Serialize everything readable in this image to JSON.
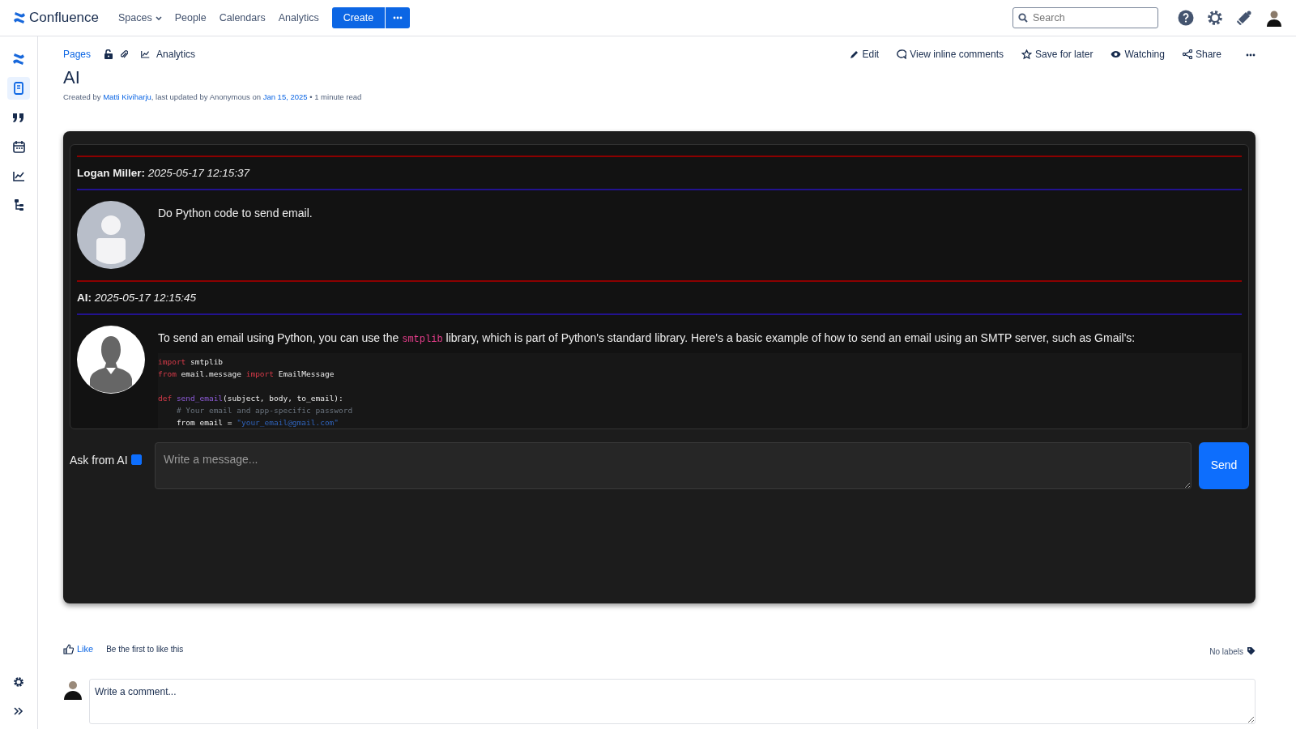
{
  "topbar": {
    "brand": "Confluence",
    "nav": [
      {
        "label": "Spaces",
        "dropdown": true
      },
      {
        "label": "People",
        "dropdown": false
      },
      {
        "label": "Calendars",
        "dropdown": false
      },
      {
        "label": "Analytics",
        "dropdown": false
      }
    ],
    "create_button": "Create",
    "search": {
      "placeholder": "Search"
    }
  },
  "sidebar": {
    "items": [
      {
        "kind": "logo",
        "selected": false
      },
      {
        "kind": "pages",
        "selected": true
      },
      {
        "kind": "quote",
        "selected": false
      },
      {
        "kind": "calendar",
        "selected": false
      },
      {
        "kind": "analytics",
        "selected": false
      },
      {
        "kind": "tree",
        "selected": false
      }
    ],
    "bottom": [
      {
        "kind": "settings"
      },
      {
        "kind": "expand"
      }
    ]
  },
  "page": {
    "breadcrumb": "Pages",
    "analytics_link": "Analytics",
    "actions": [
      {
        "kind": "edit",
        "label": "Edit"
      },
      {
        "kind": "comments",
        "label": "View inline comments"
      },
      {
        "kind": "star",
        "label": "Save for later"
      },
      {
        "kind": "watch",
        "label": "Watching"
      },
      {
        "kind": "share",
        "label": "Share"
      },
      {
        "kind": "more"
      }
    ],
    "title": "AI",
    "byline": {
      "prefix": "Created by ",
      "author": "Matti Kiviharju",
      "middle": ", last updated by Anonymous on ",
      "date": "Jan 15, 2025",
      "suffix": " • 1 minute read"
    }
  },
  "chat": {
    "messages": [
      {
        "kind": "user",
        "author": "Logan Miller:",
        "time": "2025-05-17 12:15:37",
        "parts": [
          {
            "kind": "text",
            "text": "Do Python code to send email."
          }
        ]
      },
      {
        "kind": "ai",
        "author": "AI:",
        "time": "2025-05-17 12:15:45",
        "parts": [
          {
            "kind": "text",
            "text": "To send an email using Python, you can use the "
          },
          {
            "kind": "code",
            "text": "smtplib"
          },
          {
            "kind": "text",
            "text": " library, which is part of Python's standard library. Here's a basic example of how to send an email using an SMTP server, such as Gmail's:"
          }
        ],
        "code": [
          {
            "gap_before": false,
            "tokens": [
              {
                "kind": "keyword",
                "text": "import"
              },
              {
                "kind": "plain",
                "text": " smtplib"
              }
            ]
          },
          {
            "gap_before": false,
            "tokens": [
              {
                "kind": "keyword",
                "text": "from"
              },
              {
                "kind": "plain",
                "text": " email.message "
              },
              {
                "kind": "keyword",
                "text": "import"
              },
              {
                "kind": "plain",
                "text": " EmailMessage"
              }
            ]
          },
          {
            "gap_before": true,
            "tokens": [
              {
                "kind": "keyword",
                "text": "def "
              },
              {
                "kind": "function",
                "text": "send_email"
              },
              {
                "kind": "plain",
                "text": "(subject, body, to_email):"
              }
            ]
          },
          {
            "gap_before": false,
            "tokens": [
              {
                "kind": "comment",
                "text": "    # Your email and app-specific password"
              }
            ]
          },
          {
            "gap_before": false,
            "tokens": [
              {
                "kind": "plain",
                "text": "    from email = "
              },
              {
                "kind": "string",
                "text": "\"your_email@gmail.com\""
              }
            ]
          }
        ]
      }
    ]
  },
  "composer": {
    "label": "Ask from AI",
    "checked": true,
    "placeholder": "Write a message...",
    "send": "Send"
  },
  "footer": {
    "like": "Like",
    "like_note": "Be the first to like this",
    "labels": "No labels",
    "comment_placeholder": "Write a comment..."
  }
}
